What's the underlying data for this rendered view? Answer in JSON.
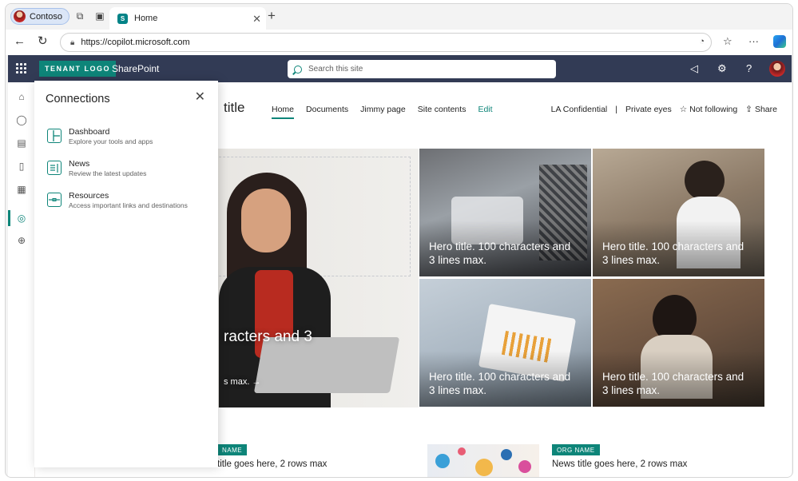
{
  "browser": {
    "profile_name": "Contoso",
    "tab_title": "Home",
    "url": "https://copilot.microsoft.com"
  },
  "suite": {
    "tenant_logo": "TENANT LOGO",
    "app_name": "SharePoint",
    "search_placeholder": "Search this site"
  },
  "site": {
    "title_fragment": "title",
    "nav": [
      {
        "label": "Home"
      },
      {
        "label": "Documents"
      },
      {
        "label": "Jimmy page"
      },
      {
        "label": "Site contents"
      },
      {
        "label": "Edit"
      }
    ],
    "meta": {
      "classification": "LA Confidential",
      "separator": "|",
      "privacy": "Private eyes",
      "follow": "Not following",
      "share": "Share"
    }
  },
  "hero": {
    "big_caption": "racters and 3",
    "big_sub": "s max.",
    "tiles": [
      {
        "caption": "Hero title. 100 characters and 3 lines max."
      },
      {
        "caption": "Hero title. 100 characters and 3 lines max."
      },
      {
        "caption": "Hero title. 100 characters and 3 lines max."
      },
      {
        "caption": "Hero title. 100 characters and 3 lines max."
      }
    ]
  },
  "news": [
    {
      "badge": "NAME",
      "title": "title goes here, 2 rows max"
    },
    {
      "badge": "ORG NAME",
      "title": "News title goes here, 2 rows max"
    }
  ],
  "panel": {
    "title": "Connections",
    "items": [
      {
        "name": "Dashboard",
        "desc": "Explore your tools and apps"
      },
      {
        "name": "News",
        "desc": "Review the latest updates"
      },
      {
        "name": "Resources",
        "desc": "Access important links and destinations"
      }
    ]
  },
  "colors": {
    "suite_bar": "#323b55",
    "accent": "#0e8579"
  }
}
